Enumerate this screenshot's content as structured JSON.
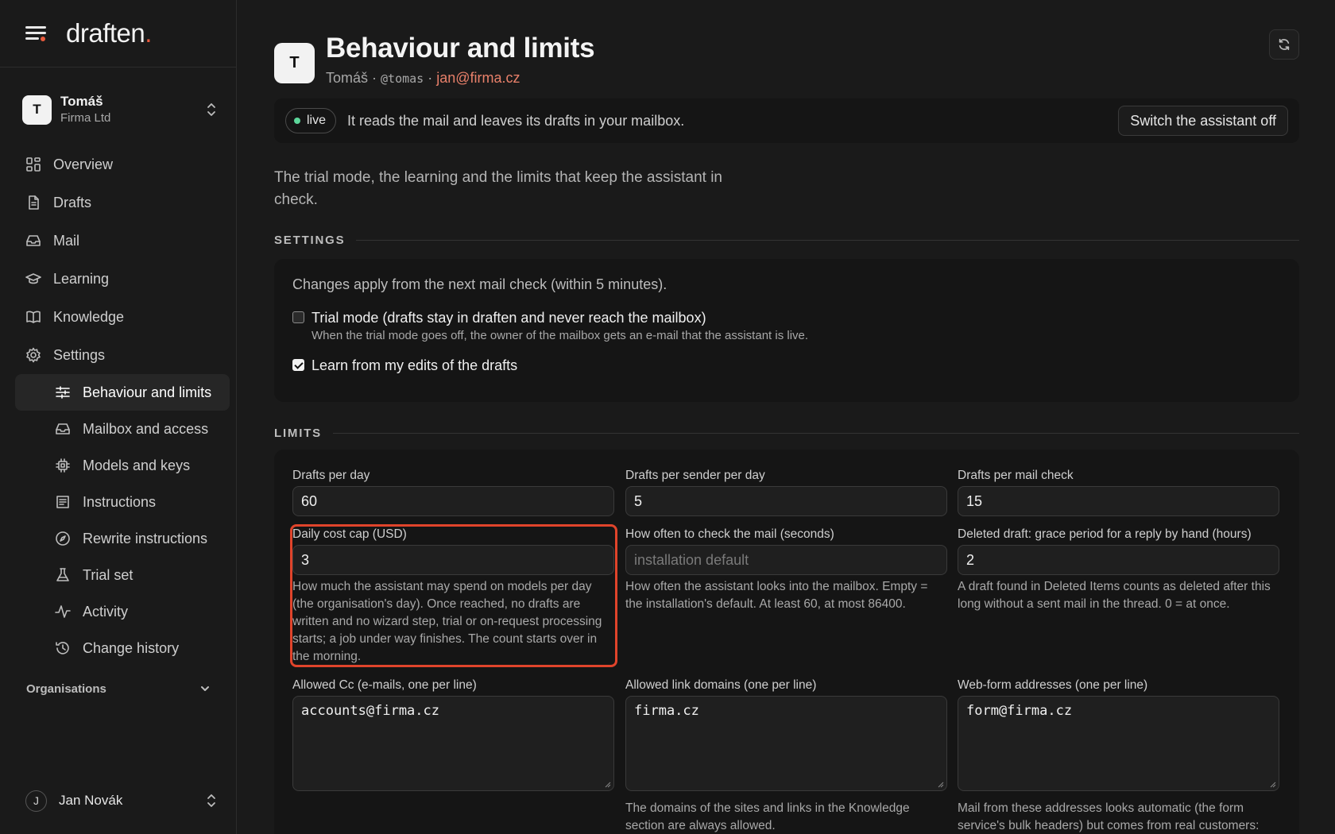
{
  "app": {
    "logo_text": "draften",
    "logo_dot": "."
  },
  "org": {
    "avatar": "T",
    "name": "Tomáš",
    "subtitle": "Firma Ltd"
  },
  "nav": {
    "items": [
      {
        "label": "Overview",
        "icon": "grid-icon"
      },
      {
        "label": "Drafts",
        "icon": "document-icon"
      },
      {
        "label": "Mail",
        "icon": "inbox-icon"
      },
      {
        "label": "Learning",
        "icon": "graduation-cap-icon"
      },
      {
        "label": "Knowledge",
        "icon": "book-icon"
      },
      {
        "label": "Settings",
        "icon": "gear-icon"
      }
    ],
    "settings_sub": [
      {
        "label": "Behaviour and limits",
        "icon": "sliders-icon",
        "active": true
      },
      {
        "label": "Mailbox and access",
        "icon": "inbox-icon"
      },
      {
        "label": "Models and keys",
        "icon": "chip-icon"
      },
      {
        "label": "Instructions",
        "icon": "list-icon"
      },
      {
        "label": "Rewrite instructions",
        "icon": "compass-icon"
      },
      {
        "label": "Trial set",
        "icon": "flask-icon"
      },
      {
        "label": "Activity",
        "icon": "pulse-icon"
      },
      {
        "label": "Change history",
        "icon": "history-icon"
      }
    ],
    "organisations_label": "Organisations"
  },
  "user": {
    "avatar": "J",
    "name": "Jan Novák"
  },
  "header": {
    "avatar": "T",
    "title": "Behaviour and limits",
    "name": "Tomáš",
    "separator": " · ",
    "handle": "@tomas",
    "email": "jan@firma.cz"
  },
  "status": {
    "badge": "live",
    "text": "It reads the mail and leaves its drafts in your mailbox.",
    "off_button": "Switch the assistant off",
    "live_color": "#5cd69a"
  },
  "intro": "The trial mode, the learning and the limits that keep the assistant in check.",
  "settings": {
    "section_label": "SETTINGS",
    "note": "Changes apply from the next mail check (within 5 minutes).",
    "trial_mode": {
      "label": "Trial mode (drafts stay in draften and never reach the mailbox)",
      "help": "When the trial mode goes off, the owner of the mailbox gets an e-mail that the assistant is live.",
      "checked": false
    },
    "learn": {
      "label": "Learn from my edits of the drafts",
      "checked": true
    }
  },
  "limits": {
    "section_label": "LIMITS",
    "drafts_per_day": {
      "label": "Drafts per day",
      "value": "60"
    },
    "drafts_per_sender": {
      "label": "Drafts per sender per day",
      "value": "5"
    },
    "drafts_per_check": {
      "label": "Drafts per mail check",
      "value": "15"
    },
    "daily_cost_cap": {
      "label": "Daily cost cap (USD)",
      "value": "3",
      "help": "How much the assistant may spend on models per day (the organisation's day). Once reached, no drafts are written and no wizard step, trial or on-request processing starts; a job under way finishes. The count starts over in the morning."
    },
    "check_interval": {
      "label": "How often to check the mail (seconds)",
      "placeholder": "installation default",
      "help": "How often the assistant looks into the mailbox. Empty = the installation's default. At least 60, at most 86400."
    },
    "grace_period": {
      "label": "Deleted draft: grace period for a reply by hand (hours)",
      "value": "2",
      "help": "A draft found in Deleted Items counts as deleted after this long without a sent mail in the thread. 0 = at once."
    },
    "allowed_cc": {
      "label": "Allowed Cc (e-mails, one per line)",
      "value": "accounts@firma.cz"
    },
    "allowed_domains": {
      "label": "Allowed link domains (one per line)",
      "value": "firma.cz",
      "help": "The domains of the sites and links in the Knowledge section are always allowed."
    },
    "webform": {
      "label": "Web-form addresses (one per line)",
      "value": "form@firma.cz",
      "help": "Mail from these addresses looks automatic (the form service's bulk headers) but comes from real customers:"
    }
  },
  "colors": {
    "accent": "#e85a3c",
    "highlight": "#e0442b",
    "email": "#e8806a"
  }
}
